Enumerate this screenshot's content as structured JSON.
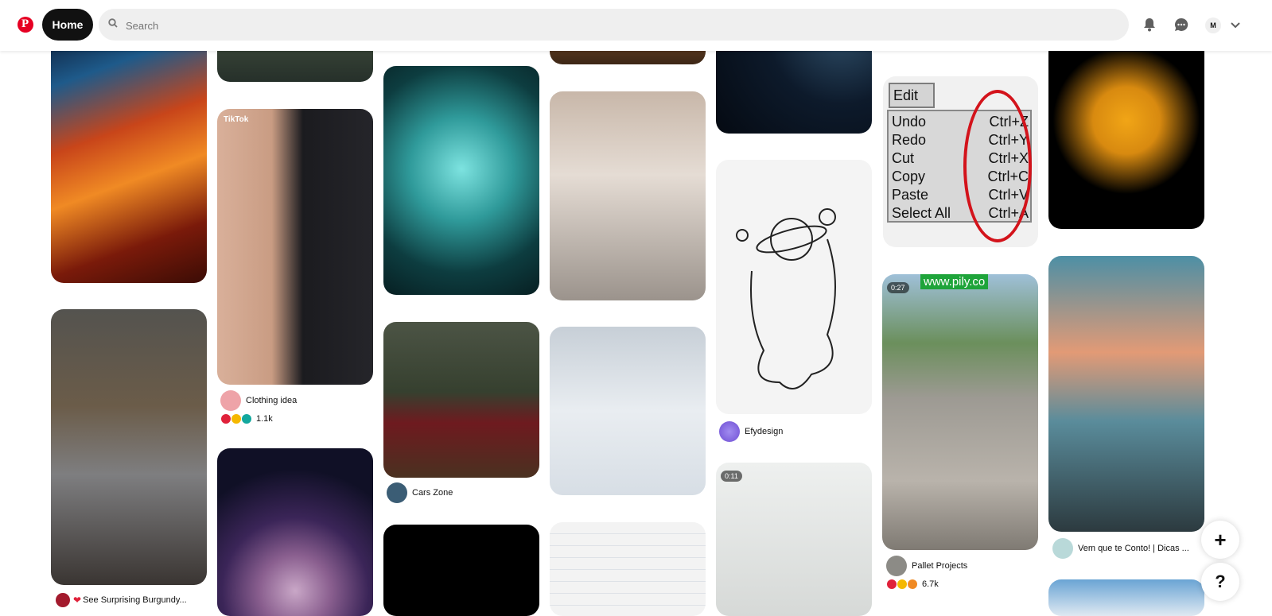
{
  "header": {
    "home_label": "Home",
    "search_placeholder": "Search",
    "avatar_initial": "M",
    "icons": [
      "pinterest-logo-icon",
      "search-icon",
      "bell-icon",
      "messages-icon",
      "chevron-down-icon"
    ]
  },
  "pins": {
    "clothing": {
      "author": "Clothing idea",
      "count": "1.1k",
      "badge": "TikTok"
    },
    "cars": {
      "author": "Cars Zone"
    },
    "efy": {
      "author": "Efydesign"
    },
    "pallet": {
      "author": "Pallet Projects",
      "count": "6.7k",
      "duration": "0:27",
      "watermark": "www.pily.co"
    },
    "vem": {
      "author": "Vem que te Conto! | Dicas ..."
    },
    "burgundy": {
      "author": "See Surprising Burgundy..."
    },
    "video2": {
      "duration": "0:11"
    }
  },
  "edit_menu": {
    "title": "Edit",
    "items": [
      {
        "label": "Undo",
        "key": "Ctrl+Z"
      },
      {
        "label": "Redo",
        "key": "Ctrl+Y"
      },
      {
        "label": "Cut",
        "key": "Ctrl+X"
      },
      {
        "label": "Copy",
        "key": "Ctrl+C"
      },
      {
        "label": "Paste",
        "key": "Ctrl+V"
      },
      {
        "label": "Select All",
        "key": "Ctrl+A"
      }
    ]
  },
  "fab": {
    "add": "+",
    "help": "?"
  },
  "colors": {
    "brand": "#e60023",
    "oval": "#d3131b"
  }
}
